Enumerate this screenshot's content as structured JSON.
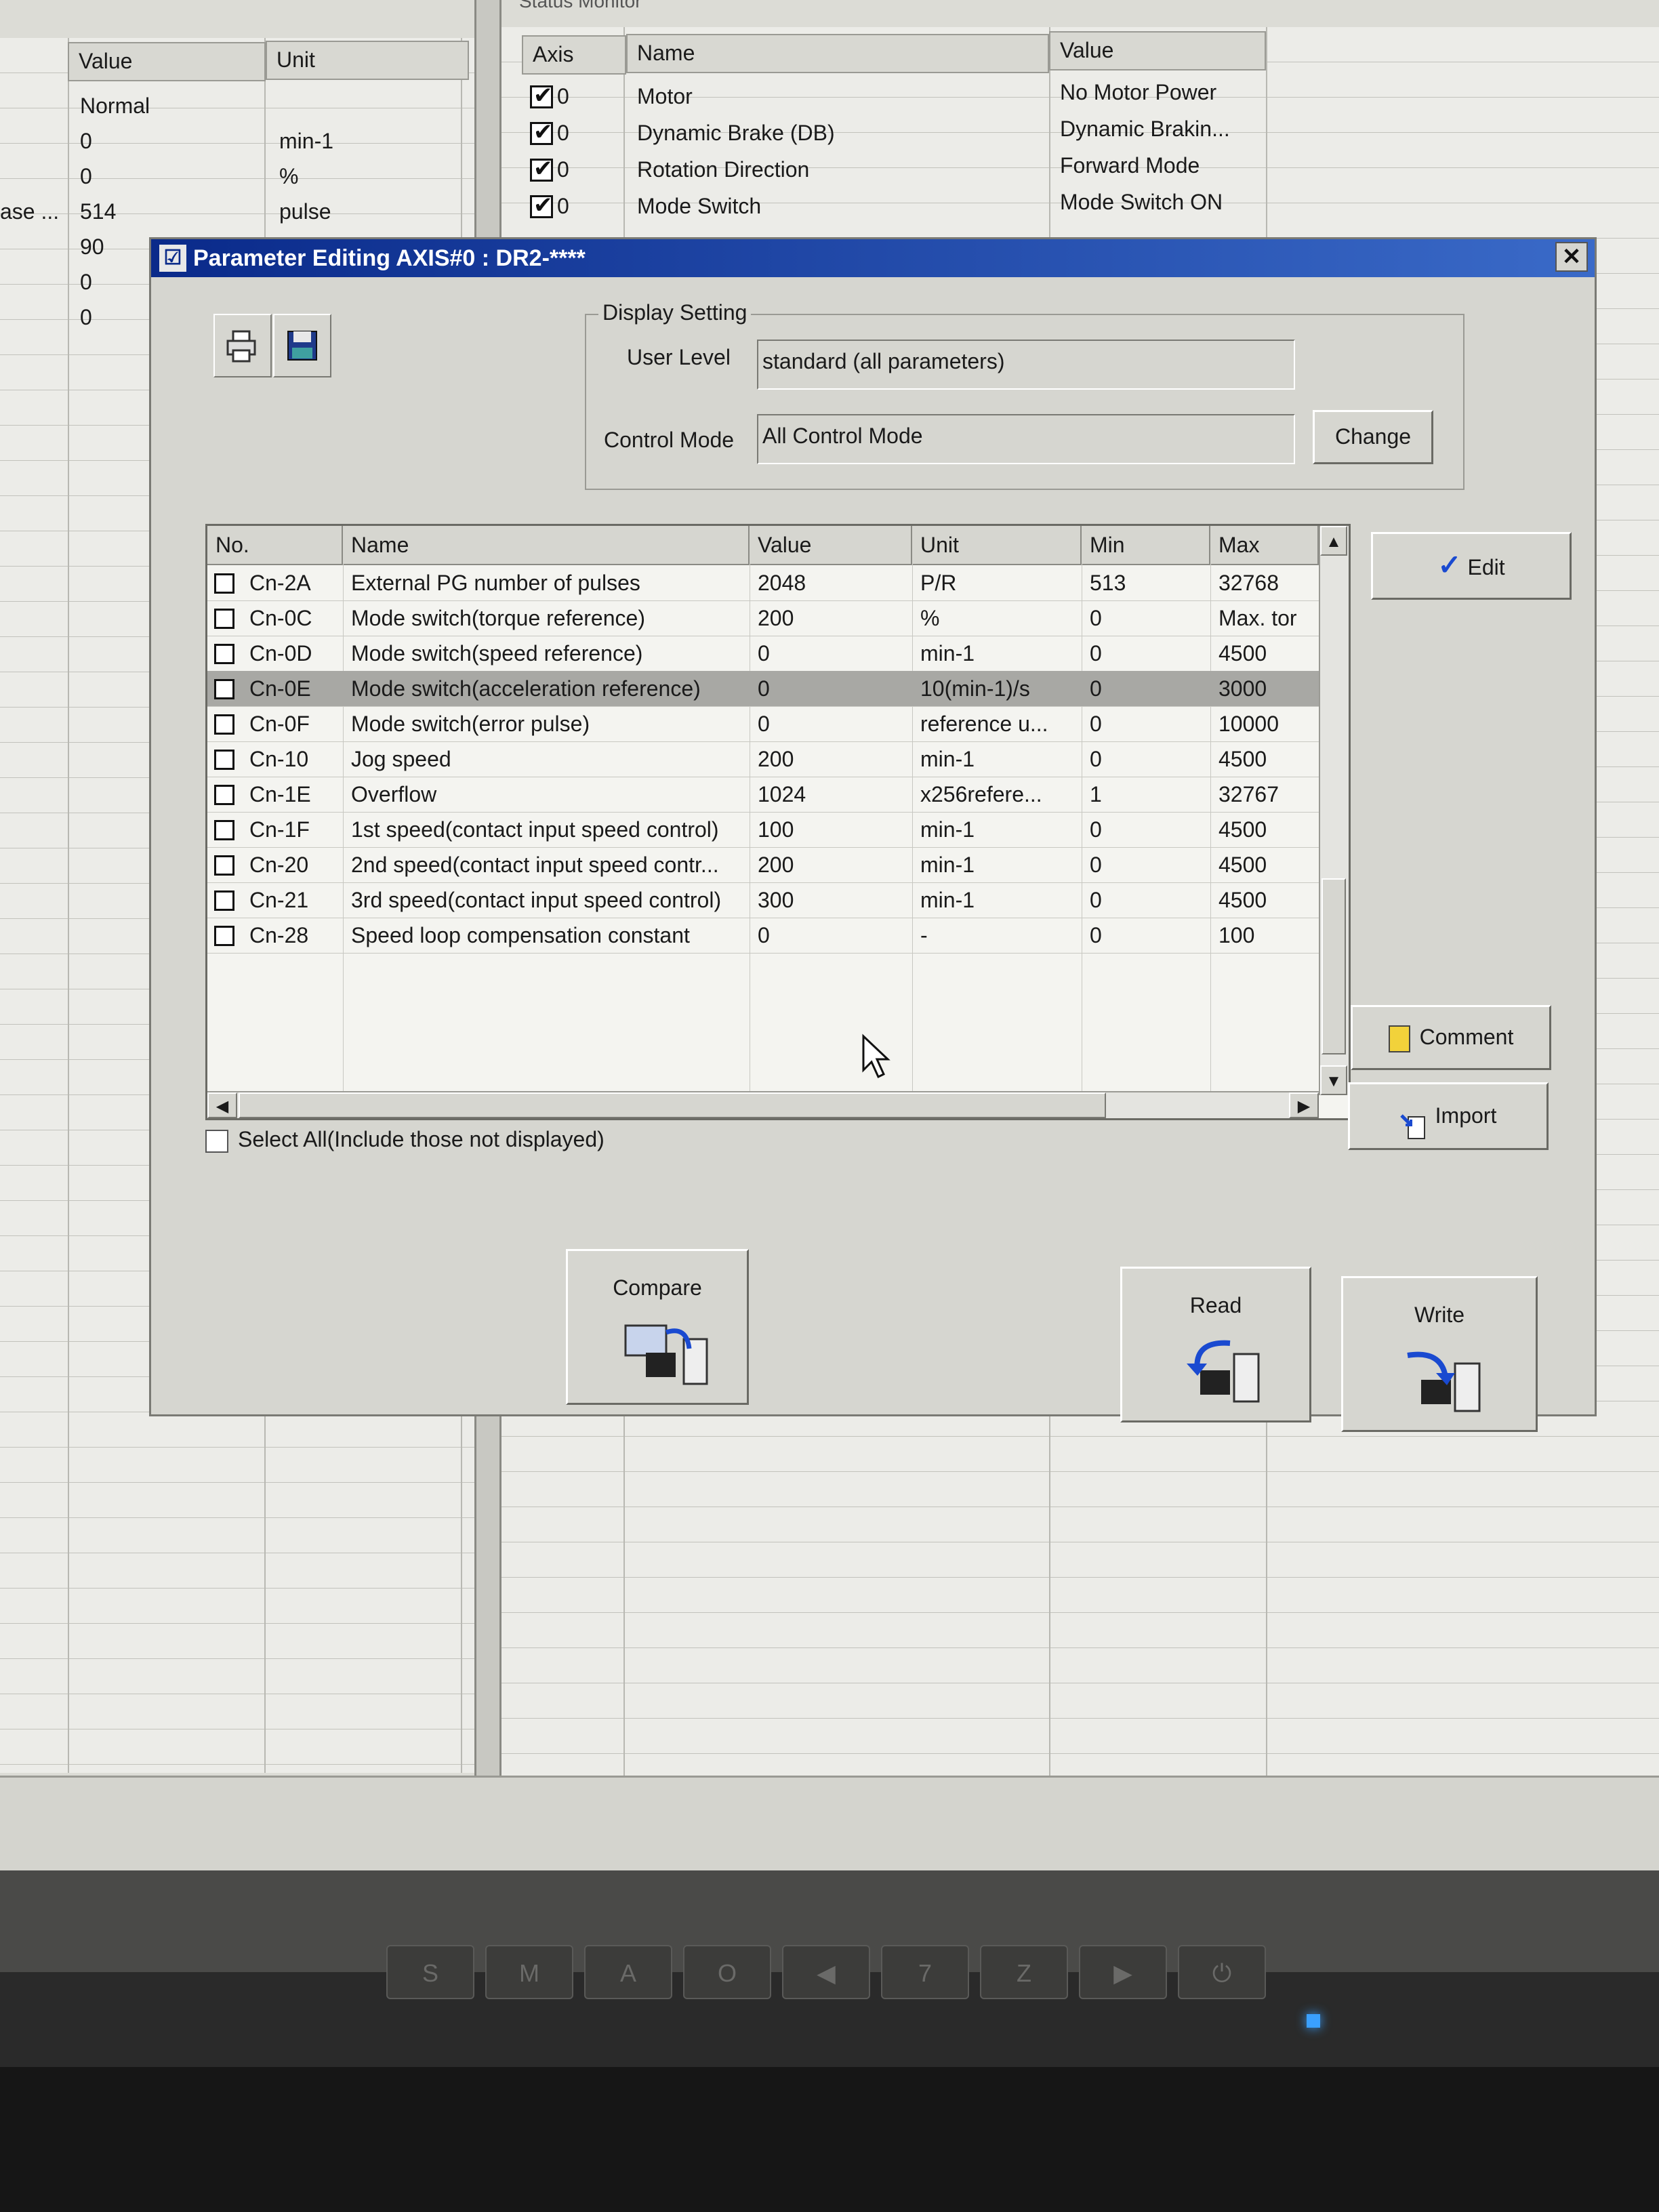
{
  "left_panel": {
    "headers": {
      "value": "Value",
      "unit": "Unit"
    },
    "rows": [
      {
        "label": "",
        "value": "Normal",
        "unit": ""
      },
      {
        "label": "",
        "value": "0",
        "unit": "min-1"
      },
      {
        "label": "",
        "value": "0",
        "unit": "%"
      },
      {
        "label": "ase ...",
        "value": "514",
        "unit": "pulse"
      },
      {
        "label": "",
        "value": "90",
        "unit": ""
      },
      {
        "label": "",
        "value": "0",
        "unit": ""
      },
      {
        "label": "",
        "value": "0",
        "unit": ""
      }
    ]
  },
  "status_monitor": {
    "title": "Status Monitor",
    "headers": {
      "axis": "Axis",
      "name": "Name",
      "value": "Value"
    },
    "rows": [
      {
        "axis": "0",
        "checked": true,
        "name": "Motor",
        "value": "No Motor Power"
      },
      {
        "axis": "0",
        "checked": true,
        "name": "Dynamic Brake (DB)",
        "value": "Dynamic Brakin..."
      },
      {
        "axis": "0",
        "checked": true,
        "name": "Rotation Direction",
        "value": "Forward Mode"
      },
      {
        "axis": "0",
        "checked": true,
        "name": "Mode Switch",
        "value": "Mode Switch ON"
      }
    ]
  },
  "dialog": {
    "title": "Parameter Editing AXIS#0 : DR2-****",
    "close_glyph": "✕",
    "display_setting": {
      "legend": "Display Setting",
      "user_level_label": "User Level",
      "user_level_value": "standard (all parameters)",
      "control_mode_label": "Control Mode",
      "control_mode_value": "All Control Mode",
      "change_label": "Change"
    },
    "table": {
      "headers": {
        "no": "No.",
        "name": "Name",
        "value": "Value",
        "unit": "Unit",
        "min": "Min",
        "max": "Max"
      },
      "rows": [
        {
          "no": "Cn-2A",
          "name": "External PG number of pulses",
          "value": "2048",
          "unit": "P/R",
          "min": "513",
          "max": "32768"
        },
        {
          "no": "Cn-0C",
          "name": "Mode switch(torque reference)",
          "value": "200",
          "unit": "%",
          "min": "0",
          "max": "Max. tor"
        },
        {
          "no": "Cn-0D",
          "name": "Mode switch(speed reference)",
          "value": "0",
          "unit": "min-1",
          "min": "0",
          "max": "4500"
        },
        {
          "no": "Cn-0E",
          "name": "Mode switch(acceleration reference)",
          "value": "0",
          "unit": "10(min-1)/s",
          "min": "0",
          "max": "3000"
        },
        {
          "no": "Cn-0F",
          "name": "Mode switch(error pulse)",
          "value": "0",
          "unit": "reference u...",
          "min": "0",
          "max": "10000"
        },
        {
          "no": "Cn-10",
          "name": "Jog speed",
          "value": "200",
          "unit": "min-1",
          "min": "0",
          "max": "4500"
        },
        {
          "no": "Cn-1E",
          "name": "Overflow",
          "value": "1024",
          "unit": "x256refere...",
          "min": "1",
          "max": "32767"
        },
        {
          "no": "Cn-1F",
          "name": "1st speed(contact input speed control)",
          "value": "100",
          "unit": "min-1",
          "min": "0",
          "max": "4500"
        },
        {
          "no": "Cn-20",
          "name": "2nd speed(contact input speed contr...",
          "value": "200",
          "unit": "min-1",
          "min": "0",
          "max": "4500"
        },
        {
          "no": "Cn-21",
          "name": "3rd speed(contact input speed control)",
          "value": "300",
          "unit": "min-1",
          "min": "0",
          "max": "4500"
        },
        {
          "no": "Cn-28",
          "name": "Speed loop compensation constant",
          "value": "0",
          "unit": "-",
          "min": "0",
          "max": "100"
        }
      ]
    },
    "select_all_label": "Select All(Include those not displayed)",
    "buttons": {
      "edit": "Edit",
      "comment": "Comment",
      "import": "Import",
      "compare": "Compare",
      "read": "Read",
      "write": "Write"
    }
  },
  "monitor_buttons": [
    "S",
    "M",
    "A",
    "O",
    "◀",
    "7",
    "Z",
    "▶",
    "⏻"
  ],
  "colors": {
    "titlebar_start": "#0a2a8a",
    "titlebar_end": "#3a6ac8",
    "selected_row": "#a8a8a4",
    "power_led": "#3aa0ff",
    "icon_blue": "#1a4ad0"
  }
}
